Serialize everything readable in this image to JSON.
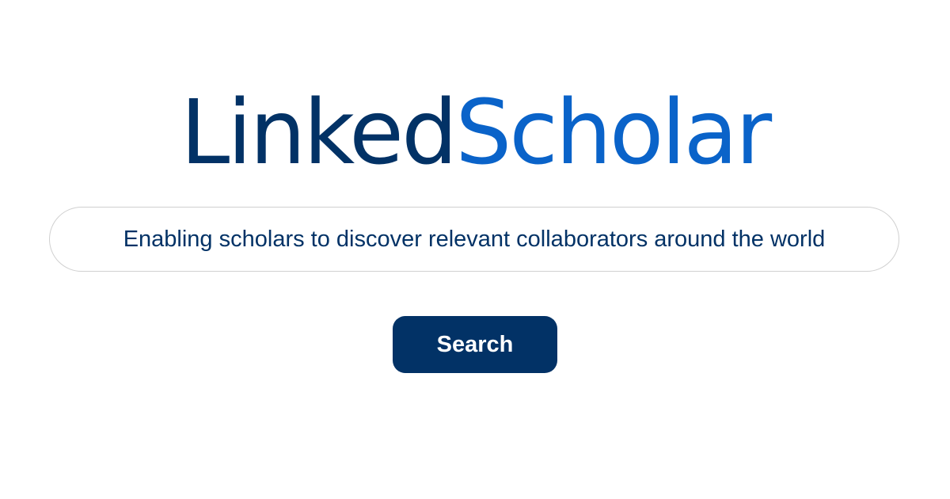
{
  "logo": {
    "part1": "Linked",
    "part2": "Scholar",
    "color_part1": "#023266",
    "color_part2": "#0a63c9"
  },
  "search": {
    "placeholder": "Enabling scholars to discover relevant collaborators around the world",
    "value": ""
  },
  "search_button": {
    "label": "Search",
    "background": "#023266",
    "text_color": "#ffffff"
  }
}
